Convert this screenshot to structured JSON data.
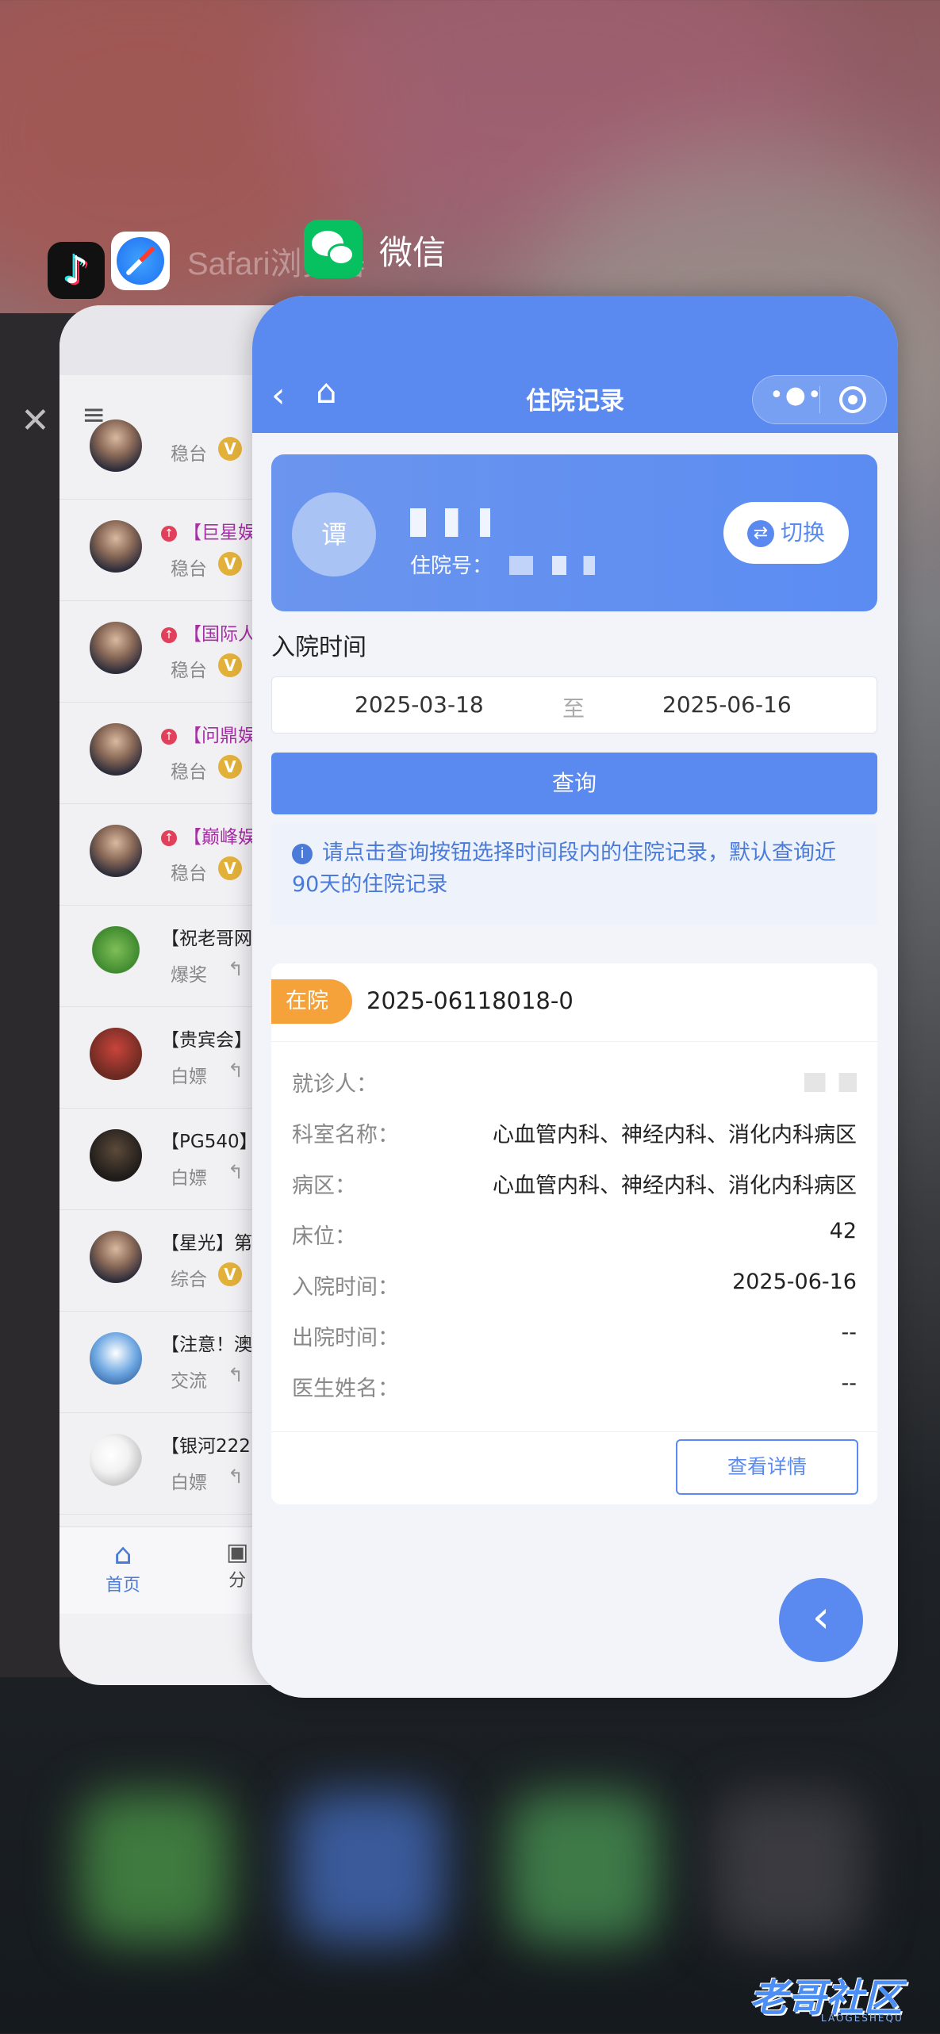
{
  "switcher": {
    "safari_label": "Safari浏览器",
    "wechat_label": "微信",
    "close": "✕"
  },
  "forum": {
    "menu_icon": "≡",
    "rows": [
      {
        "title": "",
        "tag": "稳台",
        "hot": false,
        "badge": "V",
        "avatar": "portrait",
        "partial": true
      },
      {
        "title": "【巨星娱",
        "tag": "稳台",
        "hot": true,
        "badge": "V",
        "avatar": "portrait"
      },
      {
        "title": "【国际人",
        "tag": "稳台",
        "hot": true,
        "badge": "V",
        "avatar": "portrait"
      },
      {
        "title": "【问鼎娱",
        "tag": "稳台",
        "hot": true,
        "badge": "V",
        "avatar": "portrait"
      },
      {
        "title": "【巅峰娱",
        "tag": "稳台",
        "hot": true,
        "badge": "V",
        "avatar": "portrait"
      },
      {
        "title": "【祝老哥网",
        "tag": "爆奖",
        "hot": false,
        "badge": "",
        "avatar": "frog"
      },
      {
        "title": "【贵宾会】",
        "tag": "白嫖",
        "hot": false,
        "badge": "",
        "avatar": "red"
      },
      {
        "title": "【PG540】",
        "tag": "白嫖",
        "hot": false,
        "badge": "",
        "avatar": "dark"
      },
      {
        "title": "【星光】第",
        "tag": "综合",
        "hot": false,
        "badge": "V",
        "avatar": "portrait"
      },
      {
        "title": "【注意！澳",
        "tag": "交流",
        "hot": false,
        "badge": "",
        "avatar": "sky"
      },
      {
        "title": "【银河222",
        "tag": "白嫖",
        "hot": false,
        "badge": "",
        "avatar": "toon"
      }
    ],
    "tabs": {
      "home": "首页",
      "category": "分"
    }
  },
  "miniapp": {
    "title": "住院记录",
    "patient": {
      "avatar_text": "谭",
      "inhosp_label": "住院号：",
      "switch_label": "切换"
    },
    "section_title": "入院时间",
    "date_from": "2025-03-18",
    "date_to_label": "至",
    "date_to": "2025-06-16",
    "query_label": "查询",
    "tip": "请点击查询按钮选择时间段内的住院记录，默认查询近90天的住院记录",
    "record": {
      "status": "在院",
      "record_no": "2025-06118018-0",
      "fields": [
        {
          "key": "就诊人：",
          "value": ""
        },
        {
          "key": "科室名称：",
          "value": "心血管内科、神经内科、消化内科病区"
        },
        {
          "key": "病区：",
          "value": "心血管内科、神经内科、消化内科病区"
        },
        {
          "key": "床位：",
          "value": "42"
        },
        {
          "key": "入院时间：",
          "value": "2025-06-16"
        },
        {
          "key": "出院时间：",
          "value": "--"
        },
        {
          "key": "医生姓名：",
          "value": "--"
        }
      ],
      "detail_label": "查看详情"
    }
  },
  "watermark": {
    "text": "老哥社区",
    "sub": "LAOGESHEQU"
  },
  "colors": {
    "primary": "#5a8af0",
    "status": "#f5a23a"
  }
}
